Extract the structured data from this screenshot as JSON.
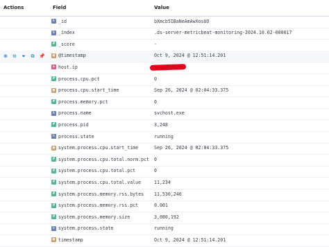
{
  "header": {
    "actions_label": "Actions",
    "field_label": "Field",
    "value_label": "Value"
  },
  "rows": [
    {
      "field": "_id",
      "value": "bXmcb5IBaNeAmAwXosUO",
      "type": "string",
      "type_glyph": "k",
      "type_color": "#6b7fad"
    },
    {
      "field": "_index",
      "value": ".ds-server-metricbeat-monitoring-2024.10.02-000017",
      "type": "string",
      "type_glyph": "k",
      "type_color": "#6b7fad"
    },
    {
      "field": "_score",
      "value": "-",
      "type": "number",
      "type_glyph": "#",
      "type_color": "#54b399"
    },
    {
      "field": "@timestamp",
      "value": "Oct 9, 2024 @ 12:51:14.201",
      "type": "date",
      "type_glyph": "▦",
      "type_color": "#c9a36f"
    },
    {
      "field": "host.ip",
      "value": "",
      "type": "ip",
      "type_glyph": "▪",
      "type_color": "#d36086"
    },
    {
      "field": "process.cpu.pct",
      "value": "0",
      "type": "number",
      "type_glyph": "#",
      "type_color": "#54b399"
    },
    {
      "field": "process.cpu.start_time",
      "value": "Sep 26, 2024 @ 02:04:33.375",
      "type": "date",
      "type_glyph": "▦",
      "type_color": "#c9a36f"
    },
    {
      "field": "process.memory.pct",
      "value": "0",
      "type": "number",
      "type_glyph": "#",
      "type_color": "#54b399"
    },
    {
      "field": "process.name",
      "value": "svchost.exe",
      "type": "string",
      "type_glyph": "k",
      "type_color": "#6b7fad"
    },
    {
      "field": "process.pid",
      "value": "3,248",
      "type": "number",
      "type_glyph": "#",
      "type_color": "#54b399"
    },
    {
      "field": "process.state",
      "value": "running",
      "type": "string",
      "type_glyph": "k",
      "type_color": "#6b7fad"
    },
    {
      "field": "system.process.cpu.start_time",
      "value": "Sep 26, 2024 @ 02:04:33.375",
      "type": "date",
      "type_glyph": "▦",
      "type_color": "#c9a36f"
    },
    {
      "field": "system.process.cpu.total.norm.pct",
      "value": "0",
      "type": "number",
      "type_glyph": "#",
      "type_color": "#54b399"
    },
    {
      "field": "system.process.cpu.total.pct",
      "value": "0",
      "type": "number",
      "type_glyph": "#",
      "type_color": "#54b399"
    },
    {
      "field": "system.process.cpu.total.value",
      "value": "11,234",
      "type": "number",
      "type_glyph": "#",
      "type_color": "#54b399"
    },
    {
      "field": "system.process.memory.rss.bytes",
      "value": "11,530,240",
      "type": "number",
      "type_glyph": "#",
      "type_color": "#54b399"
    },
    {
      "field": "system.process.memory.rss.pct",
      "value": "0.001",
      "type": "number",
      "type_glyph": "#",
      "type_color": "#54b399"
    },
    {
      "field": "system.process.memory.size",
      "value": "3,080,192",
      "type": "number",
      "type_glyph": "#",
      "type_color": "#54b399"
    },
    {
      "field": "system.process.state",
      "value": "running",
      "type": "string",
      "type_glyph": "k",
      "type_color": "#6b7fad"
    },
    {
      "field": "timestamp",
      "value": "Oct 9, 2024 @ 12:51:14.201",
      "type": "date",
      "type_glyph": "▦",
      "type_color": "#c9a36f"
    }
  ],
  "row_actions": [
    {
      "name": "filter-in-icon",
      "glyph": "⊕"
    },
    {
      "name": "filter-out-icon",
      "glyph": "⊖"
    },
    {
      "name": "filter-exists-icon",
      "glyph": "⏷"
    },
    {
      "name": "toggle-column-icon",
      "glyph": "⧉"
    },
    {
      "name": "pin-field-icon",
      "glyph": "📌"
    }
  ],
  "hover_row_index": 3
}
